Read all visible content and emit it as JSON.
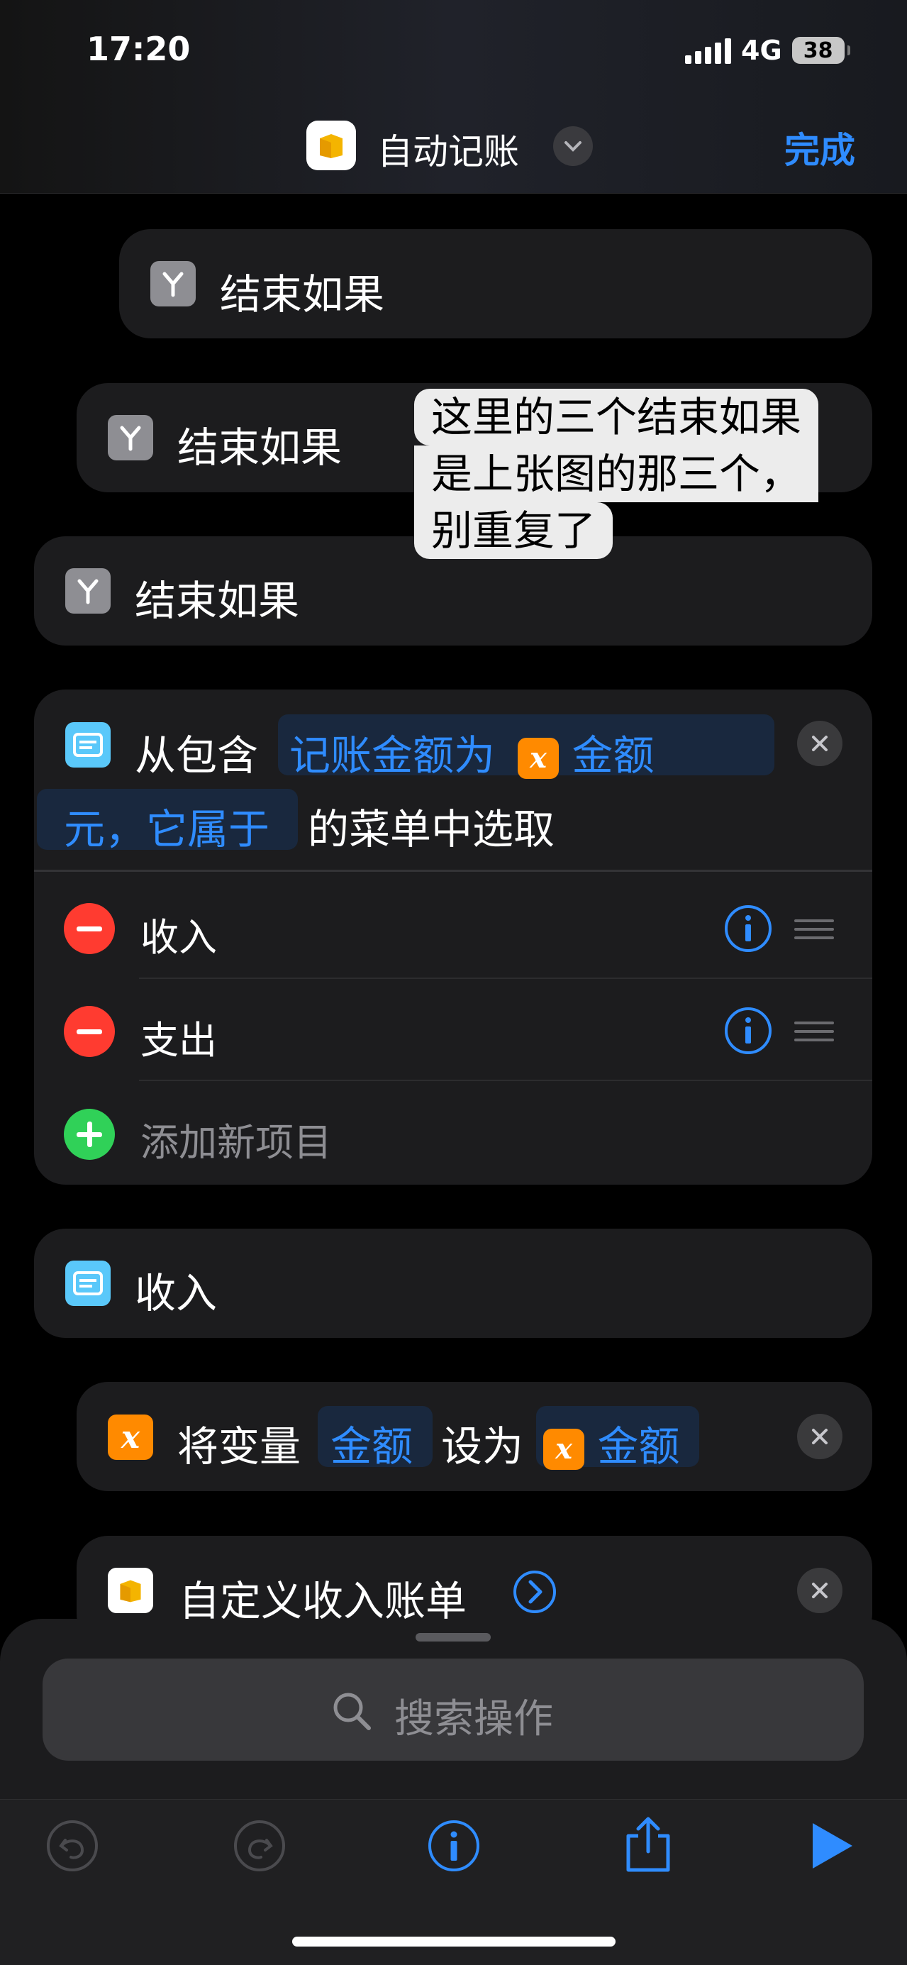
{
  "status_bar": {
    "time": "17:20",
    "network": "4G",
    "battery": "38"
  },
  "header": {
    "title": "自动记账",
    "done_label": "完成"
  },
  "blocks": {
    "end_if_1": "结束如果",
    "end_if_2": "结束如果",
    "end_if_3": "结束如果"
  },
  "annotation": {
    "line1": "这里的三个结束如果",
    "line2": "是上张图的那三个，",
    "line3": "别重复了"
  },
  "choose_menu": {
    "prefix": "从包含",
    "prompt_part1": "记账金额为",
    "prompt_var": "金额",
    "prompt_part2": "元，它属于",
    "suffix": "的菜单中选取",
    "items": [
      "收入",
      "支出"
    ],
    "add_label": "添加新项目"
  },
  "menu_case": {
    "label": "收入"
  },
  "set_variable": {
    "prefix": "将变量",
    "var_name": "金额",
    "middle": "设为",
    "value_var": "金额"
  },
  "custom_bill": {
    "label": "自定义收入账单"
  },
  "search": {
    "placeholder": "搜索操作"
  },
  "colors": {
    "accent": "#2f8cff",
    "variable_orange": "#ff8a00",
    "delete_red": "#ff3b30",
    "add_green": "#30d158",
    "menu_blue": "#5ac8fa"
  }
}
